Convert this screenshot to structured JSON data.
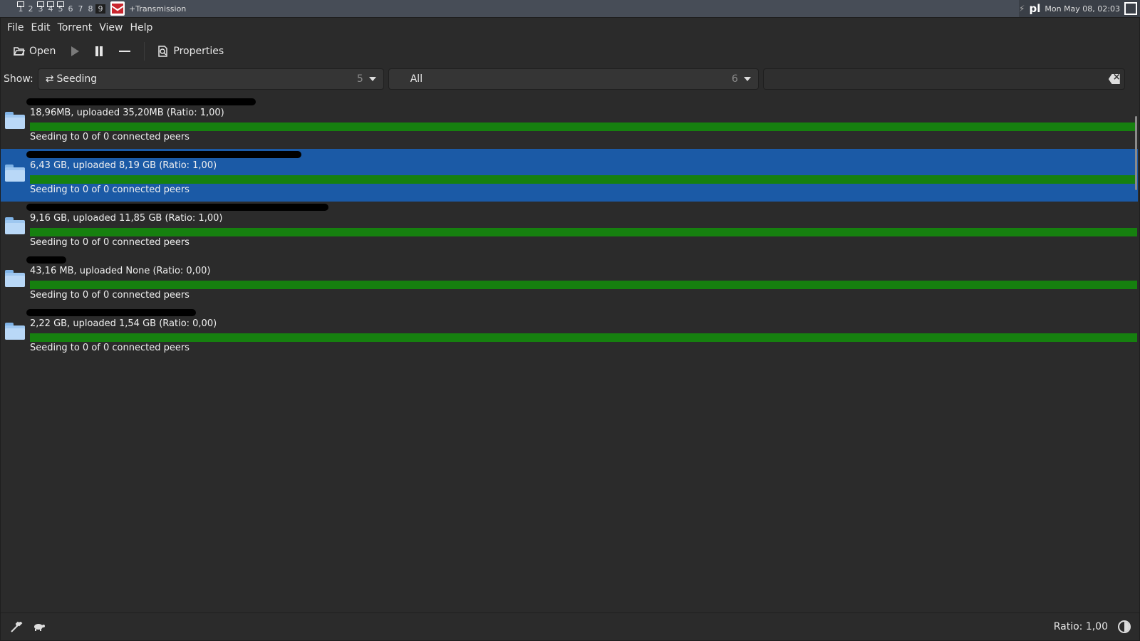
{
  "desktop": {
    "workspaces": [
      "1",
      "2",
      "3",
      "4",
      "5",
      "6",
      "7",
      "8",
      "9"
    ],
    "window_title": "+Transmission",
    "keyboard_layout": "pl",
    "clock": "Mon May 08, 02:03"
  },
  "menu": {
    "file": "File",
    "edit": "Edit",
    "torrent": "Torrent",
    "view": "View",
    "help": "Help"
  },
  "toolbar": {
    "open_label": "Open",
    "properties_label": "Properties"
  },
  "filter": {
    "show_label": "Show:",
    "activity_value": "Seeding",
    "activity_count": "5",
    "tracker_value": "All",
    "tracker_count": "6",
    "search_value": ""
  },
  "torrents": [
    {
      "size": "18,96MB, uploaded 35,20MB (Ratio: 1,00)",
      "status": "Seeding to 0 of 0 connected peers",
      "progress": 1.0,
      "selected": false
    },
    {
      "size": "6,43 GB, uploaded 8,19 GB (Ratio: 1,00)",
      "status": "Seeding to 0 of 0 connected peers",
      "progress": 1.0,
      "selected": true
    },
    {
      "size": "9,16 GB, uploaded 11,85 GB (Ratio: 1,00)",
      "status": "Seeding to 0 of 0 connected peers",
      "progress": 1.0,
      "selected": false
    },
    {
      "size": "43,16 MB, uploaded None (Ratio: 0,00)",
      "status": "Seeding to 0 of 0 connected peers",
      "progress": 1.0,
      "selected": false
    },
    {
      "size": "2,22 GB, uploaded 1,54 GB (Ratio: 0,00)",
      "status": "Seeding to 0 of 0 connected peers",
      "progress": 1.0,
      "selected": false
    }
  ],
  "statusbar": {
    "ratio": "Ratio: 1,00"
  },
  "colors": {
    "selection": "#1b5aa6",
    "progress": "#16800f",
    "background": "#2b2b2b"
  }
}
